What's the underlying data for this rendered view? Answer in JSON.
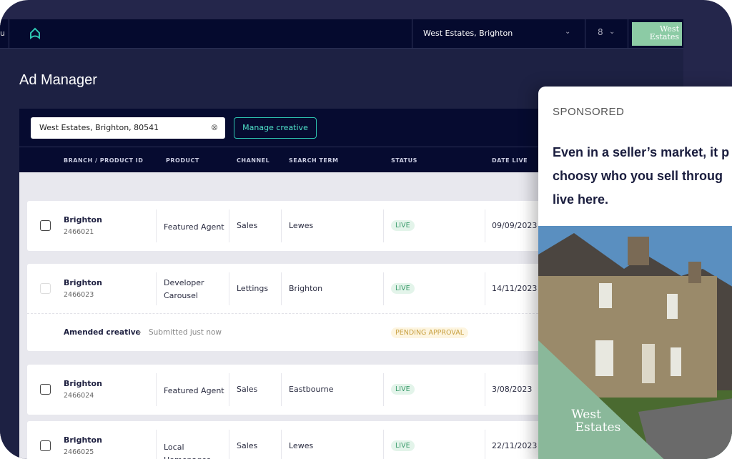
{
  "nav": {
    "menu_label": "u",
    "branch": "West Estates, Brighton",
    "logo": "West Estates"
  },
  "page_title": "Ad Manager",
  "search": {
    "value": "West Estates, Brighton, 80541"
  },
  "manage_button": "Manage creative",
  "columns": [
    "BRANCH / PRODUCT ID",
    "PRODUCT",
    "CHANNEL",
    "SEARCH TERM",
    "STATUS",
    "DATE LIVE"
  ],
  "rows": [
    {
      "branch": "Brighton",
      "id": "2466021",
      "product": "Featured Agent",
      "channel": "Sales",
      "term": "Lewes",
      "status": "LIVE",
      "date": "09/09/2023"
    },
    {
      "branch": "Brighton",
      "id": "2466023",
      "product": "Developer Carousel",
      "channel": "Lettings",
      "term": "Brighton",
      "status": "LIVE",
      "date": "14/11/2023",
      "sub": {
        "label": "Amended creative",
        "note": "Submitted just now",
        "status": "PENDING APPROVAL"
      }
    },
    {
      "branch": "Brighton",
      "id": "2466024",
      "product": "Featured Agent",
      "channel": "Sales",
      "term": "Eastbourne",
      "status": "LIVE",
      "date": "3/08/2023"
    },
    {
      "branch": "Brighton",
      "id": "2466025",
      "product": "Local Homepages",
      "channel": "Sales",
      "term": "Lewes",
      "status": "LIVE",
      "date": "22/11/2023"
    }
  ],
  "ad": {
    "sponsored": "SPONSORED",
    "headline": "Even in a seller’s market, it pays to be choosy who you sell through live here.",
    "headline_visible": [
      "Even in a seller’s market, it p",
      "choosy who you sell throug",
      "live here."
    ],
    "logo": "West Estates"
  },
  "colors": {
    "accent": "#2ec4b0",
    "nav": "#050a2e",
    "live": "#3a9a6a",
    "pending": "#c8a040",
    "brand_green": "#8ccba5"
  }
}
